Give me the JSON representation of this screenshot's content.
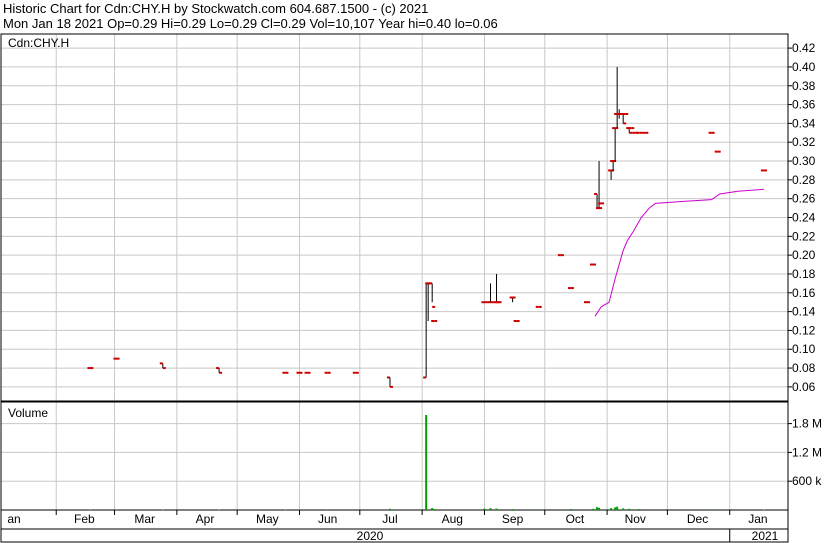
{
  "header": {
    "line1": "Historic Chart for Cdn:CHY.H by Stockwatch.com 604.687.1500 - (c) 2021",
    "line2": "Mon Jan 18 2021  Op=0.29  Hi=0.29  Lo=0.29  Cl=0.29  Vol=10,107  Year hi=0.40  lo=0.06"
  },
  "colors": {
    "price_tick": "#cc0000",
    "price_bar": "#000000",
    "moving_average": "#cc00cc",
    "volume": "#00a000",
    "grid": "#c8c8c8"
  },
  "chart_data": {
    "type": "line",
    "symbol_label": "Cdn:CHY.H",
    "volume_label": "Volume",
    "price_axis": {
      "ticks": [
        "0.42",
        "0.40",
        "0.38",
        "0.36",
        "0.34",
        "0.32",
        "0.30",
        "0.28",
        "0.26",
        "0.24",
        "0.22",
        "0.20",
        "0.18",
        "0.16",
        "0.14",
        "0.12",
        "0.10",
        "0.08",
        "0.06"
      ],
      "range": [
        0.045,
        0.435
      ]
    },
    "volume_axis": {
      "ticks": [
        "1.8 M",
        "1.2 M",
        "600 k"
      ],
      "values": [
        1800000,
        1200000,
        600000
      ],
      "range": [
        0,
        2250000
      ]
    },
    "x_axis": {
      "months": [
        "an",
        "Feb",
        "Mar",
        "Apr",
        "May",
        "Jun",
        "Jul",
        "Aug",
        "Sep",
        "Oct",
        "Nov",
        "Dec",
        "Jan"
      ],
      "years": [
        "2020",
        "2021"
      ]
    },
    "price_bars": [
      {
        "x": "2020-02-18",
        "o": 0.08,
        "h": 0.08,
        "l": 0.08,
        "c": 0.08
      },
      {
        "x": "2020-03-02",
        "o": 0.09,
        "h": 0.09,
        "l": 0.09,
        "c": 0.09
      },
      {
        "x": "2020-03-25",
        "o": 0.085,
        "h": 0.085,
        "l": 0.08,
        "c": 0.08
      },
      {
        "x": "2020-04-22",
        "o": 0.08,
        "h": 0.08,
        "l": 0.075,
        "c": 0.075
      },
      {
        "x": "2020-05-25",
        "o": 0.075,
        "h": 0.075,
        "l": 0.075,
        "c": 0.075
      },
      {
        "x": "2020-06-01",
        "o": 0.075,
        "h": 0.075,
        "l": 0.075,
        "c": 0.075
      },
      {
        "x": "2020-06-05",
        "o": 0.075,
        "h": 0.075,
        "l": 0.075,
        "c": 0.075
      },
      {
        "x": "2020-06-15",
        "o": 0.075,
        "h": 0.075,
        "l": 0.075,
        "c": 0.075
      },
      {
        "x": "2020-06-29",
        "o": 0.075,
        "h": 0.075,
        "l": 0.075,
        "c": 0.075
      },
      {
        "x": "2020-07-16",
        "o": 0.07,
        "h": 0.07,
        "l": 0.06,
        "c": 0.06
      },
      {
        "x": "2020-08-03",
        "o": 0.07,
        "h": 0.17,
        "l": 0.07,
        "c": 0.17
      },
      {
        "x": "2020-08-04",
        "o": 0.17,
        "h": 0.17,
        "l": 0.13,
        "c": 0.17
      },
      {
        "x": "2020-08-06",
        "o": 0.17,
        "h": 0.17,
        "l": 0.15,
        "c": 0.145
      },
      {
        "x": "2020-08-07",
        "o": 0.13,
        "h": 0.13,
        "l": 0.13,
        "c": 0.13
      },
      {
        "x": "2020-09-01",
        "o": 0.15,
        "h": 0.15,
        "l": 0.15,
        "c": 0.15
      },
      {
        "x": "2020-09-04",
        "o": 0.15,
        "h": 0.17,
        "l": 0.15,
        "c": 0.15
      },
      {
        "x": "2020-09-07",
        "o": 0.15,
        "h": 0.18,
        "l": 0.15,
        "c": 0.15
      },
      {
        "x": "2020-09-08",
        "o": 0.15,
        "h": 0.15,
        "l": 0.15,
        "c": 0.15
      },
      {
        "x": "2020-09-15",
        "o": 0.155,
        "h": 0.155,
        "l": 0.15,
        "c": 0.155
      },
      {
        "x": "2020-09-17",
        "o": 0.13,
        "h": 0.13,
        "l": 0.13,
        "c": 0.13
      },
      {
        "x": "2020-09-28",
        "o": 0.145,
        "h": 0.145,
        "l": 0.145,
        "c": 0.145
      },
      {
        "x": "2020-10-09",
        "o": 0.2,
        "h": 0.2,
        "l": 0.2,
        "c": 0.2
      },
      {
        "x": "2020-10-14",
        "o": 0.165,
        "h": 0.165,
        "l": 0.165,
        "c": 0.165
      },
      {
        "x": "2020-10-22",
        "o": 0.15,
        "h": 0.15,
        "l": 0.15,
        "c": 0.15
      },
      {
        "x": "2020-10-25",
        "o": 0.19,
        "h": 0.19,
        "l": 0.19,
        "c": 0.19
      },
      {
        "x": "2020-10-27",
        "o": 0.265,
        "h": 0.265,
        "l": 0.25,
        "c": 0.25
      },
      {
        "x": "2020-10-28",
        "o": 0.25,
        "h": 0.3,
        "l": 0.25,
        "c": 0.25
      },
      {
        "x": "2020-10-29",
        "o": 0.255,
        "h": 0.255,
        "l": 0.255,
        "c": 0.255
      },
      {
        "x": "2020-11-03",
        "o": 0.29,
        "h": 0.29,
        "l": 0.28,
        "c": 0.29
      },
      {
        "x": "2020-11-04",
        "o": 0.3,
        "h": 0.3,
        "l": 0.29,
        "c": 0.3
      },
      {
        "x": "2020-11-05",
        "o": 0.335,
        "h": 0.335,
        "l": 0.3,
        "c": 0.335
      },
      {
        "x": "2020-11-06",
        "o": 0.35,
        "h": 0.4,
        "l": 0.335,
        "c": 0.35
      },
      {
        "x": "2020-11-07",
        "o": 0.35,
        "h": 0.355,
        "l": 0.345,
        "c": 0.35
      },
      {
        "x": "2020-11-09",
        "o": 0.35,
        "h": 0.35,
        "l": 0.34,
        "c": 0.34
      },
      {
        "x": "2020-11-10",
        "o": 0.35,
        "h": 0.35,
        "l": 0.35,
        "c": 0.35
      },
      {
        "x": "2020-11-12",
        "o": 0.335,
        "h": 0.335,
        "l": 0.33,
        "c": 0.33
      },
      {
        "x": "2020-11-13",
        "o": 0.335,
        "h": 0.335,
        "l": 0.335,
        "c": 0.335
      },
      {
        "x": "2020-11-15",
        "o": 0.33,
        "h": 0.33,
        "l": 0.33,
        "c": 0.33
      },
      {
        "x": "2020-11-17",
        "o": 0.33,
        "h": 0.33,
        "l": 0.33,
        "c": 0.33
      },
      {
        "x": "2020-11-20",
        "o": 0.33,
        "h": 0.33,
        "l": 0.33,
        "c": 0.33
      },
      {
        "x": "2020-12-23",
        "o": 0.33,
        "h": 0.33,
        "l": 0.33,
        "c": 0.33
      },
      {
        "x": "2020-12-26",
        "o": 0.31,
        "h": 0.31,
        "l": 0.31,
        "c": 0.31
      },
      {
        "x": "2021-01-18",
        "o": 0.29,
        "h": 0.29,
        "l": 0.29,
        "c": 0.29
      }
    ],
    "moving_average": [
      {
        "x": "2020-10-26",
        "y": 0.135
      },
      {
        "x": "2020-10-29",
        "y": 0.145
      },
      {
        "x": "2020-11-02",
        "y": 0.15
      },
      {
        "x": "2020-11-05",
        "y": 0.175
      },
      {
        "x": "2020-11-09",
        "y": 0.205
      },
      {
        "x": "2020-11-11",
        "y": 0.215
      },
      {
        "x": "2020-11-14",
        "y": 0.225
      },
      {
        "x": "2020-11-18",
        "y": 0.24
      },
      {
        "x": "2020-11-22",
        "y": 0.25
      },
      {
        "x": "2020-11-25",
        "y": 0.255
      },
      {
        "x": "2020-12-08",
        "y": 0.257
      },
      {
        "x": "2020-12-23",
        "y": 0.259
      },
      {
        "x": "2020-12-27",
        "y": 0.265
      },
      {
        "x": "2021-01-05",
        "y": 0.268
      },
      {
        "x": "2021-01-18",
        "y": 0.27
      }
    ],
    "volume": [
      {
        "x": "2020-02-18",
        "v": 8000
      },
      {
        "x": "2020-03-02",
        "v": 6000
      },
      {
        "x": "2020-03-25",
        "v": 8000
      },
      {
        "x": "2020-04-22",
        "v": 10000
      },
      {
        "x": "2020-05-25",
        "v": 8000
      },
      {
        "x": "2020-06-01",
        "v": 6000
      },
      {
        "x": "2020-06-15",
        "v": 6000
      },
      {
        "x": "2020-07-16",
        "v": 25000
      },
      {
        "x": "2020-08-03",
        "v": 1980000
      },
      {
        "x": "2020-08-06",
        "v": 40000
      },
      {
        "x": "2020-08-07",
        "v": 20000
      },
      {
        "x": "2020-09-01",
        "v": 30000
      },
      {
        "x": "2020-09-04",
        "v": 40000
      },
      {
        "x": "2020-09-07",
        "v": 30000
      },
      {
        "x": "2020-09-15",
        "v": 20000
      },
      {
        "x": "2020-09-28",
        "v": 15000
      },
      {
        "x": "2020-10-14",
        "v": 20000
      },
      {
        "x": "2020-10-25",
        "v": 25000
      },
      {
        "x": "2020-10-27",
        "v": 60000
      },
      {
        "x": "2020-10-28",
        "v": 45000
      },
      {
        "x": "2020-11-03",
        "v": 40000
      },
      {
        "x": "2020-11-05",
        "v": 55000
      },
      {
        "x": "2020-11-06",
        "v": 70000
      },
      {
        "x": "2020-11-09",
        "v": 35000
      },
      {
        "x": "2020-11-12",
        "v": 25000
      },
      {
        "x": "2020-11-17",
        "v": 20000
      },
      {
        "x": "2020-12-23",
        "v": 15000
      },
      {
        "x": "2021-01-18",
        "v": 10107
      }
    ]
  }
}
